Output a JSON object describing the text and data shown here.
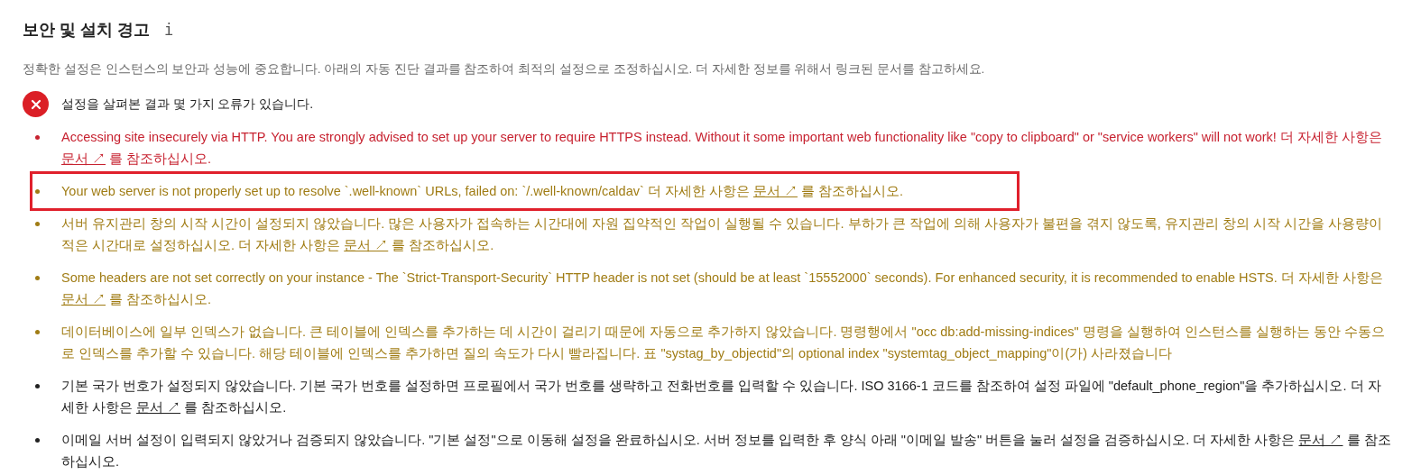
{
  "section": {
    "title": "보안 및 설치 경고",
    "info_icon": "i",
    "description": "정확한 설정은 인스턴스의 보안과 성능에 중요합니다. 아래의 자동 진단 결과를 참조하여 최적의 설정으로 조정하십시오. 더 자세한 정보를 위해서 링크된 문서를 참고하세요."
  },
  "status": {
    "kind": "error",
    "message": "설정을 살펴본 결과 몇 가지 오류가 있습니다."
  },
  "issues": [
    {
      "kind": "error",
      "highlighted": false,
      "text": "Accessing site insecurely via HTTP. You are strongly advised to set up your server to require HTTPS instead. Without it some important web functionality like \"copy to clipboard\" or \"service workers\" will not work! 더 자세한 사항은",
      "link": "문서 ↗",
      "after": "를 참조하십시오."
    },
    {
      "kind": "warning",
      "highlighted": true,
      "text": "Your web server is not properly set up to resolve `.well-known` URLs, failed on: `/.well-known/caldav` 더 자세한 사항은",
      "link": "문서 ↗",
      "after": "를 참조하십시오."
    },
    {
      "kind": "warning",
      "highlighted": false,
      "text": "서버 유지관리 창의 시작 시간이 설정되지 않았습니다. 많은 사용자가 접속하는 시간대에 자원 집약적인 작업이 실행될 수 있습니다. 부하가 큰 작업에 의해 사용자가 불편을 겪지 않도록, 유지관리 창의 시작 시간을 사용량이 적은 시간대로 설정하십시오. 더 자세한 사항은",
      "link": "문서 ↗",
      "after": "를 참조하십시오."
    },
    {
      "kind": "warning",
      "highlighted": false,
      "text": "Some headers are not set correctly on your instance - The `Strict-Transport-Security` HTTP header is not set (should be at least `15552000` seconds). For enhanced security, it is recommended to enable HSTS. 더 자세한 사항은",
      "link": "문서 ↗",
      "after": "를 참조하십시오."
    },
    {
      "kind": "warning",
      "highlighted": false,
      "text": "데이터베이스에 일부 인덱스가 없습니다. 큰 테이블에 인덱스를 추가하는 데 시간이 걸리기 때문에 자동으로 추가하지 않았습니다. 명령행에서 \"occ db:add-missing-indices\" 명령을 실행하여 인스턴스를 실행하는 동안 수동으로 인덱스를 추가할 수 있습니다. 해당 테이블에 인덱스를 추가하면 질의 속도가 다시 빨라집니다. 표 \"systag_by_objectid\"의 optional index \"systemtag_object_mapping\"이(가) 사라졌습니다"
    },
    {
      "kind": "info",
      "highlighted": false,
      "text": "기본 국가 번호가 설정되지 않았습니다. 기본 국가 번호를 설정하면 프로필에서 국가 번호를 생략하고 전화번호를 입력할 수 있습니다. ISO 3166-1 코드를 참조하여 설정 파일에 \"default_phone_region\"을 추가하십시오. 더 자세한 사항은",
      "link": "문서 ↗",
      "after": "를 참조하십시오."
    },
    {
      "kind": "info",
      "highlighted": false,
      "text": "이메일 서버 설정이 입력되지 않았거나 검증되지 않았습니다. \"기본 설정\"으로 이동해 설정을 완료하십시오. 서버 정보를 입력한 후 양식 아래 \"이메일 발송\" 버튼을 눌러 설정을 검증하십시오. 더 자세한 사항은",
      "link": "문서 ↗",
      "after": "를 참조하십시오."
    }
  ]
}
